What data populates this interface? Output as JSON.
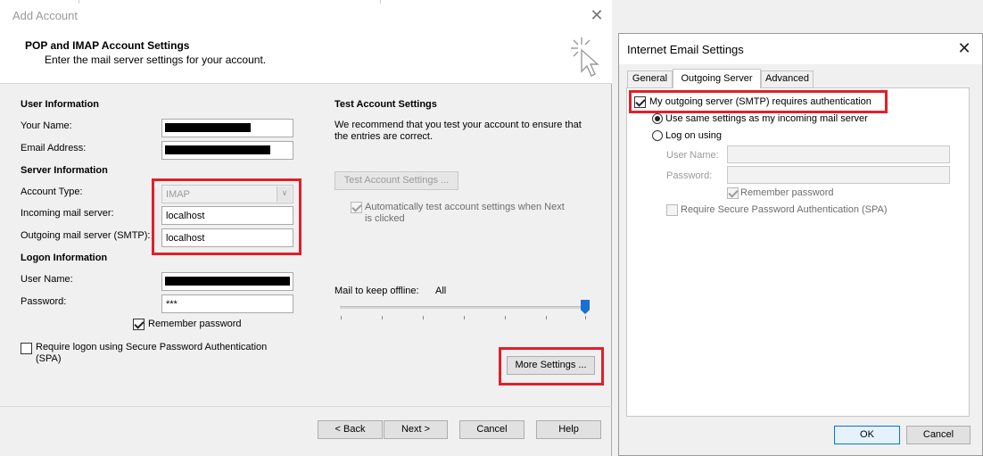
{
  "add_account": {
    "title": "Add Account",
    "header_title": "POP and IMAP Account Settings",
    "header_subtitle": "Enter the mail server settings for your account.",
    "user_info": {
      "heading": "User Information",
      "name_label": "Your Name:",
      "email_label": "Email Address:"
    },
    "server_info": {
      "heading": "Server Information",
      "account_type_label": "Account Type:",
      "account_type_value": "IMAP",
      "incoming_label": "Incoming mail server:",
      "incoming_value": "localhost",
      "outgoing_label": "Outgoing mail server (SMTP):",
      "outgoing_value": "localhost"
    },
    "logon_info": {
      "heading": "Logon Information",
      "username_label": "User Name:",
      "password_label": "Password:",
      "password_value": "***",
      "remember_label": "Remember password",
      "spa_label_1": "Require logon using Secure Password Authentication",
      "spa_label_2": "(SPA)"
    },
    "test_settings": {
      "heading": "Test Account Settings",
      "desc_1": "We recommend that you test your account to ensure that",
      "desc_2": "the entries are correct.",
      "button": "Test Account Settings ...",
      "auto_test_1": "Automatically test account settings when Next",
      "auto_test_2": "is clicked"
    },
    "offline": {
      "label": "Mail to keep offline:",
      "value": "All",
      "slider_level": 1.0
    },
    "more_settings_button": "More Settings ...",
    "footer": {
      "back": "< Back",
      "next": "Next >",
      "cancel": "Cancel",
      "help": "Help"
    }
  },
  "internet_email_settings": {
    "title": "Internet Email Settings",
    "tabs": [
      "General",
      "Outgoing Server",
      "Advanced"
    ],
    "active_tab": "Outgoing Server",
    "smtp_auth_label": "My outgoing server (SMTP) requires authentication",
    "use_same_label": "Use same settings as my incoming mail server",
    "log_on_label": "Log on using",
    "username_label": "User Name:",
    "password_label": "Password:",
    "remember_label": "Remember password",
    "spa_label": "Require Secure Password Authentication (SPA)",
    "ok": "OK",
    "cancel": "Cancel"
  },
  "colors": {
    "highlight_red": "#e0202a",
    "slider_blue": "#1a6fd6"
  }
}
